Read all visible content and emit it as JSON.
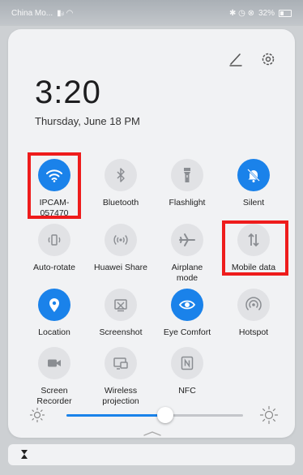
{
  "status_bar": {
    "carrier": "China Mo...",
    "battery": "32%"
  },
  "header": {
    "time": "3:20",
    "date": "Thursday, June 18  PM"
  },
  "tiles": [
    {
      "label": "IPCAM-\n057470",
      "icon": "wifi-icon",
      "active": true
    },
    {
      "label": "Bluetooth",
      "icon": "bluetooth-icon",
      "active": false
    },
    {
      "label": "Flashlight",
      "icon": "flashlight-icon",
      "active": false
    },
    {
      "label": "Silent",
      "icon": "bell-off-icon",
      "active": true
    },
    {
      "label": "Auto-rotate",
      "icon": "auto-rotate-icon",
      "active": false
    },
    {
      "label": "Huawei Share",
      "icon": "huawei-share-icon",
      "active": false
    },
    {
      "label": "Airplane\nmode",
      "icon": "airplane-icon",
      "active": false
    },
    {
      "label": "Mobile data",
      "icon": "mobile-data-icon",
      "active": false
    },
    {
      "label": "Location",
      "icon": "location-icon",
      "active": true
    },
    {
      "label": "Screenshot",
      "icon": "screenshot-icon",
      "active": false
    },
    {
      "label": "Eye Comfort",
      "icon": "eye-icon",
      "active": true
    },
    {
      "label": "Hotspot",
      "icon": "hotspot-icon",
      "active": false
    },
    {
      "label": "Screen\nRecorder",
      "icon": "screen-recorder-icon",
      "active": false
    },
    {
      "label": "Wireless\nprojection",
      "icon": "wireless-projection-icon",
      "active": false
    },
    {
      "label": "NFC",
      "icon": "nfc-icon",
      "active": false
    }
  ],
  "brightness": {
    "level": 0.56
  },
  "colors": {
    "accent": "#1a82ea",
    "highlight": "#ee1c1c"
  }
}
